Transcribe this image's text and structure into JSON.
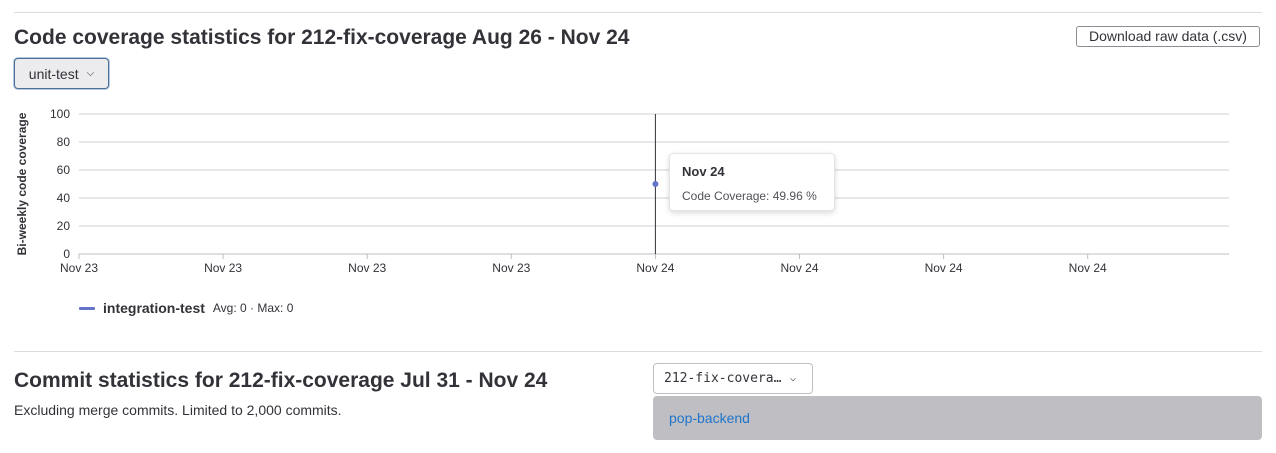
{
  "coverage": {
    "title": "Code coverage statistics for 212-fix-coverage Aug 26 - Nov 24",
    "download_label": "Download raw data (.csv)",
    "job_dropdown": {
      "selected": "unit-test"
    },
    "tooltip": {
      "title": "Nov 24",
      "body": "Code Coverage: 49.96 %"
    },
    "legend": {
      "name": "integration-test",
      "stats": "Avg: 0 · Max: 0"
    }
  },
  "chart_data": {
    "type": "line",
    "ylabel": "Bi-weekly code coverage",
    "xlabel": "",
    "ylim": [
      0,
      100
    ],
    "yticks": [
      "0",
      "20",
      "40",
      "60",
      "80",
      "100"
    ],
    "xticks": [
      "Nov 23",
      "Nov 23",
      "Nov 23",
      "Nov 23",
      "Nov 24",
      "Nov 24",
      "Nov 24",
      "Nov 24"
    ],
    "grid": true,
    "series": [
      {
        "name": "integration-test",
        "color": "#6574c9",
        "points": [
          {
            "x": "Nov 24",
            "y": 49.96
          }
        ]
      }
    ],
    "cursor_x": "Nov 24"
  },
  "commits": {
    "title": "Commit statistics for 212-fix-coverage Jul 31 - Nov 24",
    "subtitle": "Excluding merge commits. Limited to 2,000 commits.",
    "branch_dropdown": {
      "selected": "212-fix-coverage",
      "options": [
        "pop-backend"
      ]
    }
  }
}
